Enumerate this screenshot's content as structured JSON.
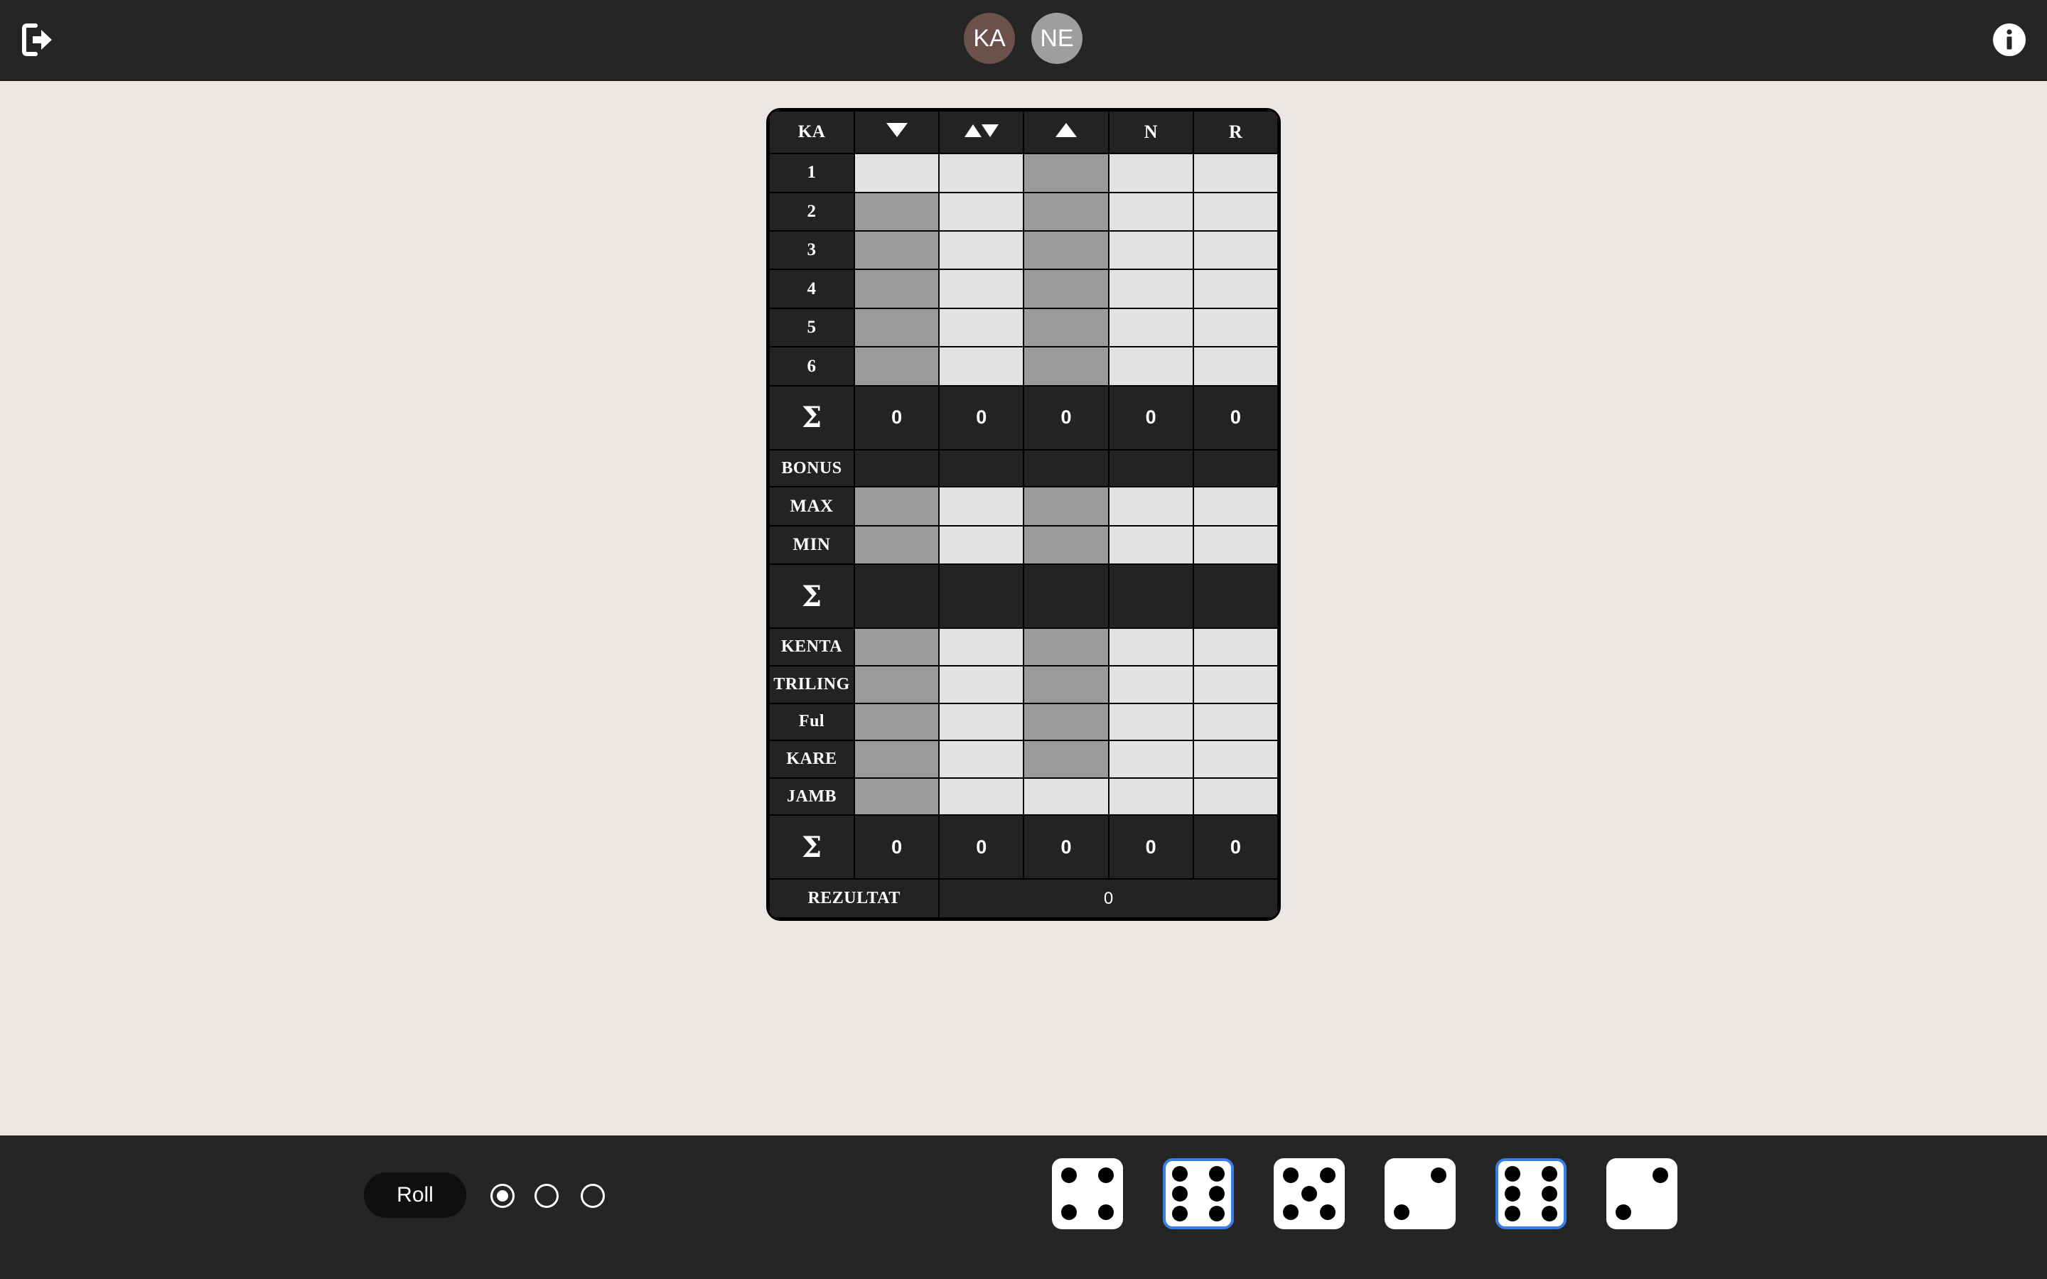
{
  "top_bar": {
    "exit_icon": "exit-icon",
    "info_icon": "info-icon",
    "players": [
      {
        "initials": "KA",
        "color": "#6b5149"
      },
      {
        "initials": "NE",
        "color": "#9e9e9e"
      }
    ]
  },
  "sheet": {
    "player": "KA",
    "columns": [
      {
        "icon": "arrow-down-icon"
      },
      {
        "icon": "arrow-up-down-icon"
      },
      {
        "icon": "arrow-up-icon"
      },
      {
        "label": "N"
      },
      {
        "label": "R"
      }
    ],
    "upper_rows": [
      {
        "label": "1",
        "cells": [
          "light",
          "light",
          "gray",
          "light",
          "light"
        ]
      },
      {
        "label": "2",
        "cells": [
          "gray",
          "light",
          "gray",
          "light",
          "light"
        ]
      },
      {
        "label": "3",
        "cells": [
          "gray",
          "light",
          "gray",
          "light",
          "light"
        ]
      },
      {
        "label": "4",
        "cells": [
          "gray",
          "light",
          "gray",
          "light",
          "light"
        ]
      },
      {
        "label": "5",
        "cells": [
          "gray",
          "light",
          "gray",
          "light",
          "light"
        ]
      },
      {
        "label": "6",
        "cells": [
          "gray",
          "light",
          "gray",
          "light",
          "light"
        ]
      }
    ],
    "upper_sum": {
      "label": "Σ",
      "values": [
        "0",
        "0",
        "0",
        "0",
        "0"
      ]
    },
    "bonus": {
      "label": "BONUS"
    },
    "middle_rows": [
      {
        "label": "MAX",
        "cells": [
          "gray",
          "light",
          "gray",
          "light",
          "light"
        ]
      },
      {
        "label": "MIN",
        "cells": [
          "gray",
          "light",
          "gray",
          "light",
          "light"
        ]
      }
    ],
    "middle_sum": {
      "label": "Σ"
    },
    "lower_rows": [
      {
        "label": "KENTA",
        "cells": [
          "gray",
          "light",
          "gray",
          "light",
          "light"
        ]
      },
      {
        "label": "TRILING",
        "cells": [
          "gray",
          "light",
          "gray",
          "light",
          "light"
        ]
      },
      {
        "label": "Ful",
        "cells": [
          "gray",
          "light",
          "gray",
          "light",
          "light"
        ]
      },
      {
        "label": "KARE",
        "cells": [
          "gray",
          "light",
          "gray",
          "light",
          "light"
        ]
      },
      {
        "label": "JAMB",
        "cells": [
          "gray",
          "light",
          "light",
          "light",
          "light"
        ]
      }
    ],
    "lower_sum": {
      "label": "Σ",
      "values": [
        "0",
        "0",
        "0",
        "0",
        "0"
      ]
    },
    "result": {
      "label": "REZULTAT",
      "value": "0"
    }
  },
  "bottom_bar": {
    "roll_label": "Roll",
    "rolls": [
      true,
      false,
      false
    ],
    "dice": [
      {
        "value": 4,
        "held": false
      },
      {
        "value": 6,
        "held": true
      },
      {
        "value": 5,
        "held": false
      },
      {
        "value": 2,
        "held": false
      },
      {
        "value": 6,
        "held": true
      },
      {
        "value": 2,
        "held": false
      }
    ],
    "held_color": "#3b7de6"
  }
}
